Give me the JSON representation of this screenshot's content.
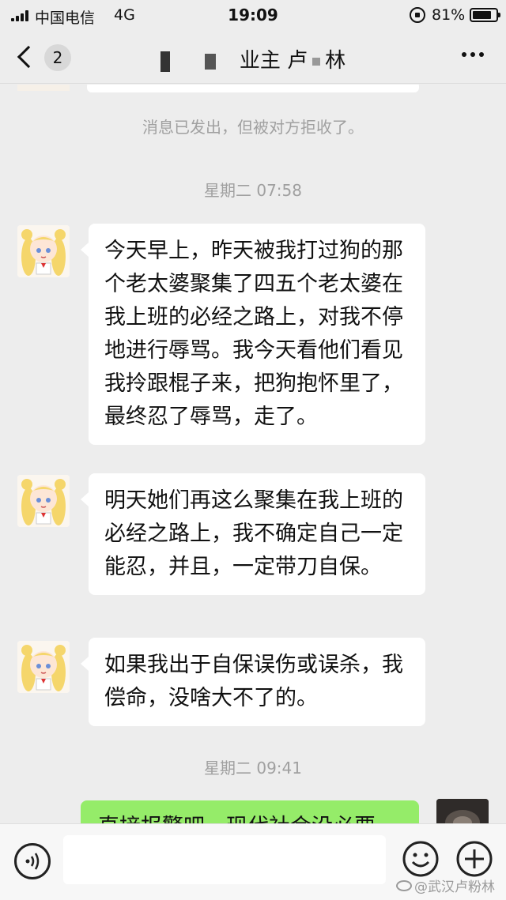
{
  "status_bar": {
    "carrier": "中国电信",
    "network": "4G",
    "time": "19:09",
    "battery": "81%",
    "battery_level": 0.81
  },
  "nav": {
    "unread_count": "2",
    "title_mid": "业主 卢",
    "title_end": "林"
  },
  "chat": {
    "system_notice": "消息已发出，但被对方拒收了。",
    "timestamp_1": "星期二 07:58",
    "messages": [
      {
        "text": "今天早上，昨天被我打过狗的那个老太婆聚集了四五个老太婆在我上班的必经之路上，对我不停地进行辱骂。我今天看他们看见我拎跟棍子来，把狗抱怀里了，最终忍了辱骂，走了。"
      },
      {
        "text": "明天她们再这么聚集在我上班的必经之路上，我不确定自己一定能忍，并且，一定带刀自保。"
      },
      {
        "text": "如果我出于自保误伤或误杀，我偿命，没啥大不了的。"
      }
    ],
    "timestamp_2": "星期二 09:41",
    "self_message": "直接报警吧，现代社会没必要"
  },
  "watermark": "@武汉卢粉林"
}
